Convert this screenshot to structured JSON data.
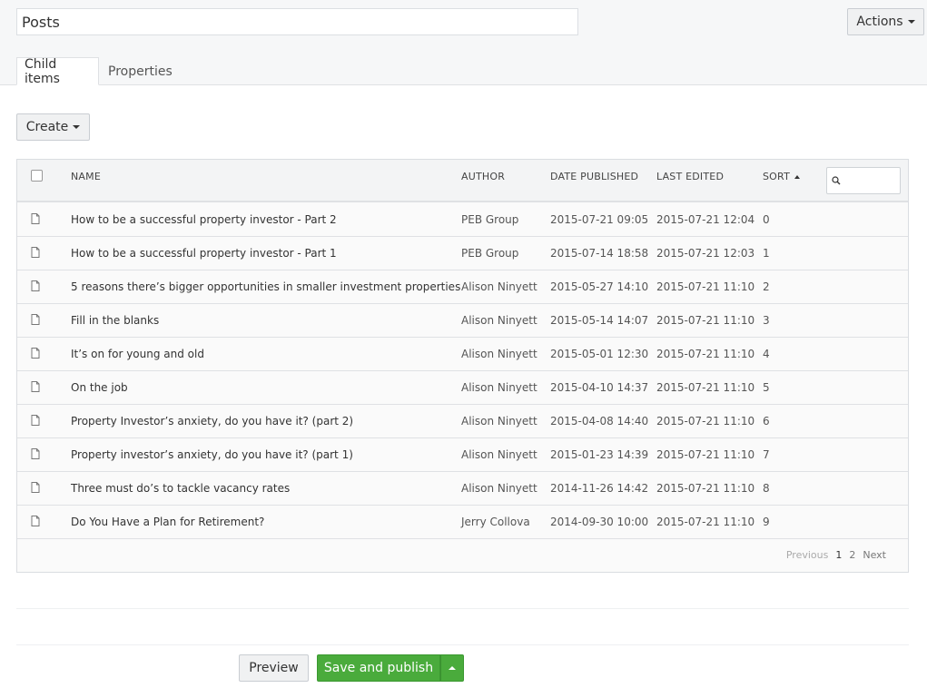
{
  "header": {
    "title_value": "Posts",
    "actions_label": "Actions"
  },
  "tabs": [
    {
      "label": "Child items",
      "active": true
    },
    {
      "label": "Properties",
      "active": false
    }
  ],
  "toolbar": {
    "create_label": "Create"
  },
  "table": {
    "columns": [
      "NAME",
      "AUTHOR",
      "DATE PUBLISHED",
      "LAST EDITED",
      "SORT"
    ],
    "rows": [
      {
        "name": "How to be a successful property investor - Part 2",
        "author": "PEB Group",
        "published": "2015-07-21 09:05",
        "edited": "2015-07-21 12:04",
        "sort": "0"
      },
      {
        "name": "How to be a successful property investor - Part 1",
        "author": "PEB Group",
        "published": "2015-07-14 18:58",
        "edited": "2015-07-21 12:03",
        "sort": "1"
      },
      {
        "name": "5 reasons there’s bigger opportunities in smaller investment properties",
        "author": "Alison Ninyett",
        "published": "2015-05-27 14:10",
        "edited": "2015-07-21 11:10",
        "sort": "2"
      },
      {
        "name": "Fill in the blanks",
        "author": "Alison Ninyett",
        "published": "2015-05-14 14:07",
        "edited": "2015-07-21 11:10",
        "sort": "3"
      },
      {
        "name": "It’s on for young and old",
        "author": "Alison Ninyett",
        "published": "2015-05-01 12:30",
        "edited": "2015-07-21 11:10",
        "sort": "4"
      },
      {
        "name": "On the job",
        "author": "Alison Ninyett",
        "published": "2015-04-10 14:37",
        "edited": "2015-07-21 11:10",
        "sort": "5"
      },
      {
        "name": "Property Investor’s anxiety, do you have it? (part 2)",
        "author": "Alison Ninyett",
        "published": "2015-04-08 14:40",
        "edited": "2015-07-21 11:10",
        "sort": "6"
      },
      {
        "name": "Property investor’s anxiety, do you have it? (part 1)",
        "author": "Alison Ninyett",
        "published": "2015-01-23 14:39",
        "edited": "2015-07-21 11:10",
        "sort": "7"
      },
      {
        "name": "Three must do’s to tackle vacancy rates",
        "author": "Alison Ninyett",
        "published": "2014-11-26 14:42",
        "edited": "2015-07-21 11:10",
        "sort": "8"
      },
      {
        "name": "Do You Have a Plan for Retirement?",
        "author": "Jerry Collova",
        "published": "2014-09-30 10:00",
        "edited": "2015-07-21 11:10",
        "sort": "9"
      }
    ],
    "pagination": {
      "previous": "Previous",
      "pages": [
        "1",
        "2"
      ],
      "current": "1",
      "next": "Next"
    }
  },
  "footer": {
    "preview_label": "Preview",
    "publish_label": "Save and publish"
  },
  "colors": {
    "publish_green": "#4aab3c"
  }
}
